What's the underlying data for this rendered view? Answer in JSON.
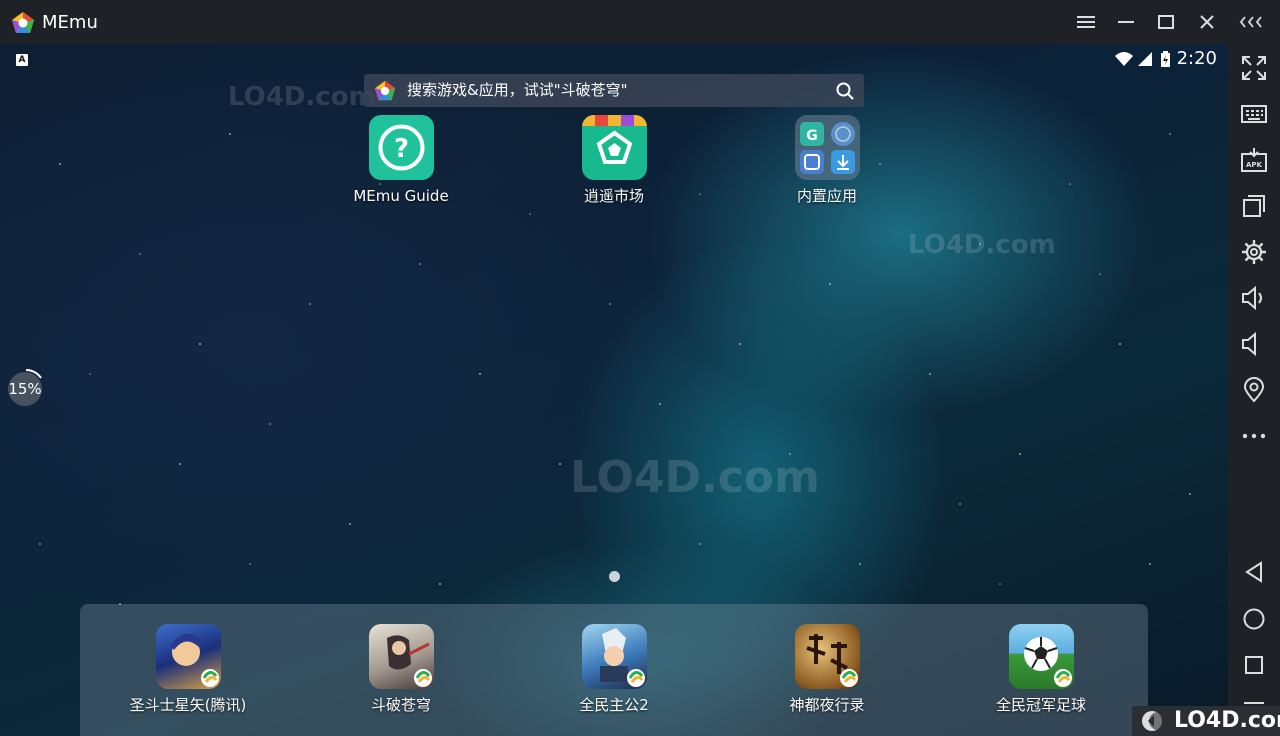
{
  "window": {
    "title": "MEmu"
  },
  "status_bar": {
    "ime_label": "A",
    "time": "2:20"
  },
  "search": {
    "placeholder": "搜索游戏&应用，试试\"斗破苍穹\""
  },
  "desktop_apps": [
    {
      "label": "MEmu Guide"
    },
    {
      "label": "逍遥市场"
    },
    {
      "label": "内置应用"
    }
  ],
  "dock_apps": [
    {
      "label": "圣斗士星矢(腾讯)"
    },
    {
      "label": "斗破苍穹"
    },
    {
      "label": "全民主公2"
    },
    {
      "label": "神都夜行录"
    },
    {
      "label": "全民冠军足球"
    }
  ],
  "progress": {
    "label": "15%",
    "value": 15
  },
  "watermark": {
    "text": "LO4D.com"
  },
  "colors": {
    "guide_icon": "#1fc29a",
    "market_icon": "#19b98f",
    "titlebar": "#1e2226"
  }
}
